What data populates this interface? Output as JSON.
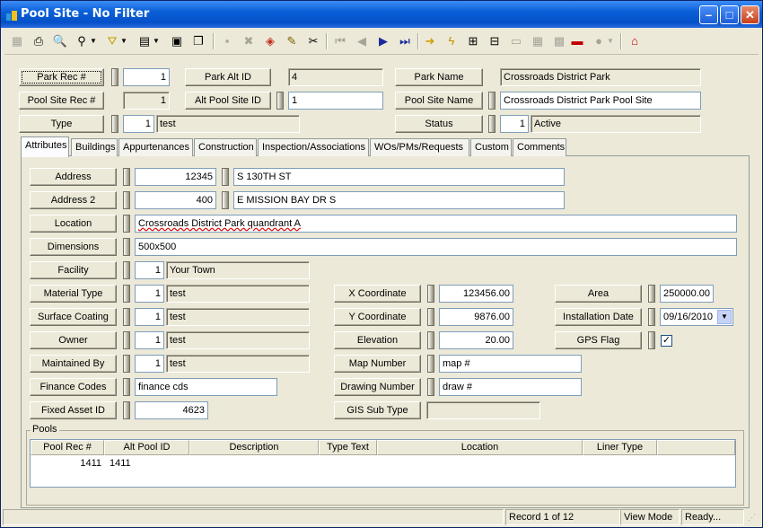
{
  "window": {
    "title": "Pool Site - No Filter"
  },
  "header": {
    "park_rec_label": "Park Rec #",
    "park_rec_value": "1",
    "park_alt_id_label": "Park Alt ID",
    "park_alt_id_value": "4",
    "park_name_label": "Park Name",
    "park_name_value": "Crossroads District Park",
    "pool_site_rec_label": "Pool Site Rec #",
    "pool_site_rec_value": "1",
    "alt_pool_site_id_label": "Alt Pool Site ID",
    "alt_pool_site_id_value": "1",
    "pool_site_name_label": "Pool Site Name",
    "pool_site_name_value": "Crossroads District Park Pool Site",
    "type_label": "Type",
    "type_code": "1",
    "type_text": "test",
    "status_label": "Status",
    "status_code": "1",
    "status_text": "Active"
  },
  "tabs": [
    "Attributes",
    "Buildings",
    "Appurtenances",
    "Construction",
    "Inspection/Associations",
    "WOs/PMs/Requests",
    "Custom",
    "Comments"
  ],
  "attributes": {
    "address_label": "Address",
    "address_number": "12345",
    "address_street": "S 130TH ST",
    "address2_label": "Address 2",
    "address2_number": "400",
    "address2_street": "E MISSION BAY DR S",
    "location_label": "Location",
    "location_value": "Crossroads District Park quandrant A",
    "dimensions_label": "Dimensions",
    "dimensions_value": "500x500",
    "facility_label": "Facility",
    "facility_code": "1",
    "facility_text": "Your Town",
    "material_type_label": "Material Type",
    "material_type_code": "1",
    "material_type_text": "test",
    "surface_coating_label": "Surface Coating",
    "surface_coating_code": "1",
    "surface_coating_text": "test",
    "owner_label": "Owner",
    "owner_code": "1",
    "owner_text": "test",
    "maintained_by_label": "Maintained By",
    "maintained_by_code": "1",
    "maintained_by_text": "test",
    "finance_codes_label": "Finance Codes",
    "finance_codes_value": "finance cds",
    "fixed_asset_id_label": "Fixed Asset ID",
    "fixed_asset_id_value": "4623",
    "x_coordinate_label": "X Coordinate",
    "x_coordinate_value": "123456.00",
    "y_coordinate_label": "Y Coordinate",
    "y_coordinate_value": "9876.00",
    "elevation_label": "Elevation",
    "elevation_value": "20.00",
    "map_number_label": "Map Number",
    "map_number_value": "map #",
    "drawing_number_label": "Drawing Number",
    "drawing_number_value": "draw #",
    "gis_sub_type_label": "GIS Sub Type",
    "gis_sub_type_value": "",
    "area_label": "Area",
    "area_value": "250000.00",
    "installation_date_label": "Installation Date",
    "installation_date_value": "09/16/2010",
    "gps_flag_label": "GPS Flag",
    "gps_flag_checked": "✓"
  },
  "pools": {
    "group_label": "Pools",
    "columns": [
      "Pool Rec #",
      "Alt Pool ID",
      "Description",
      "Type Text",
      "Location",
      "Liner Type"
    ],
    "rows": [
      {
        "pool_rec": "1411",
        "alt_pool_id": "1411"
      }
    ]
  },
  "statusbar": {
    "record": "Record 1 of 12",
    "mode": "View Mode",
    "state": "Ready..."
  }
}
